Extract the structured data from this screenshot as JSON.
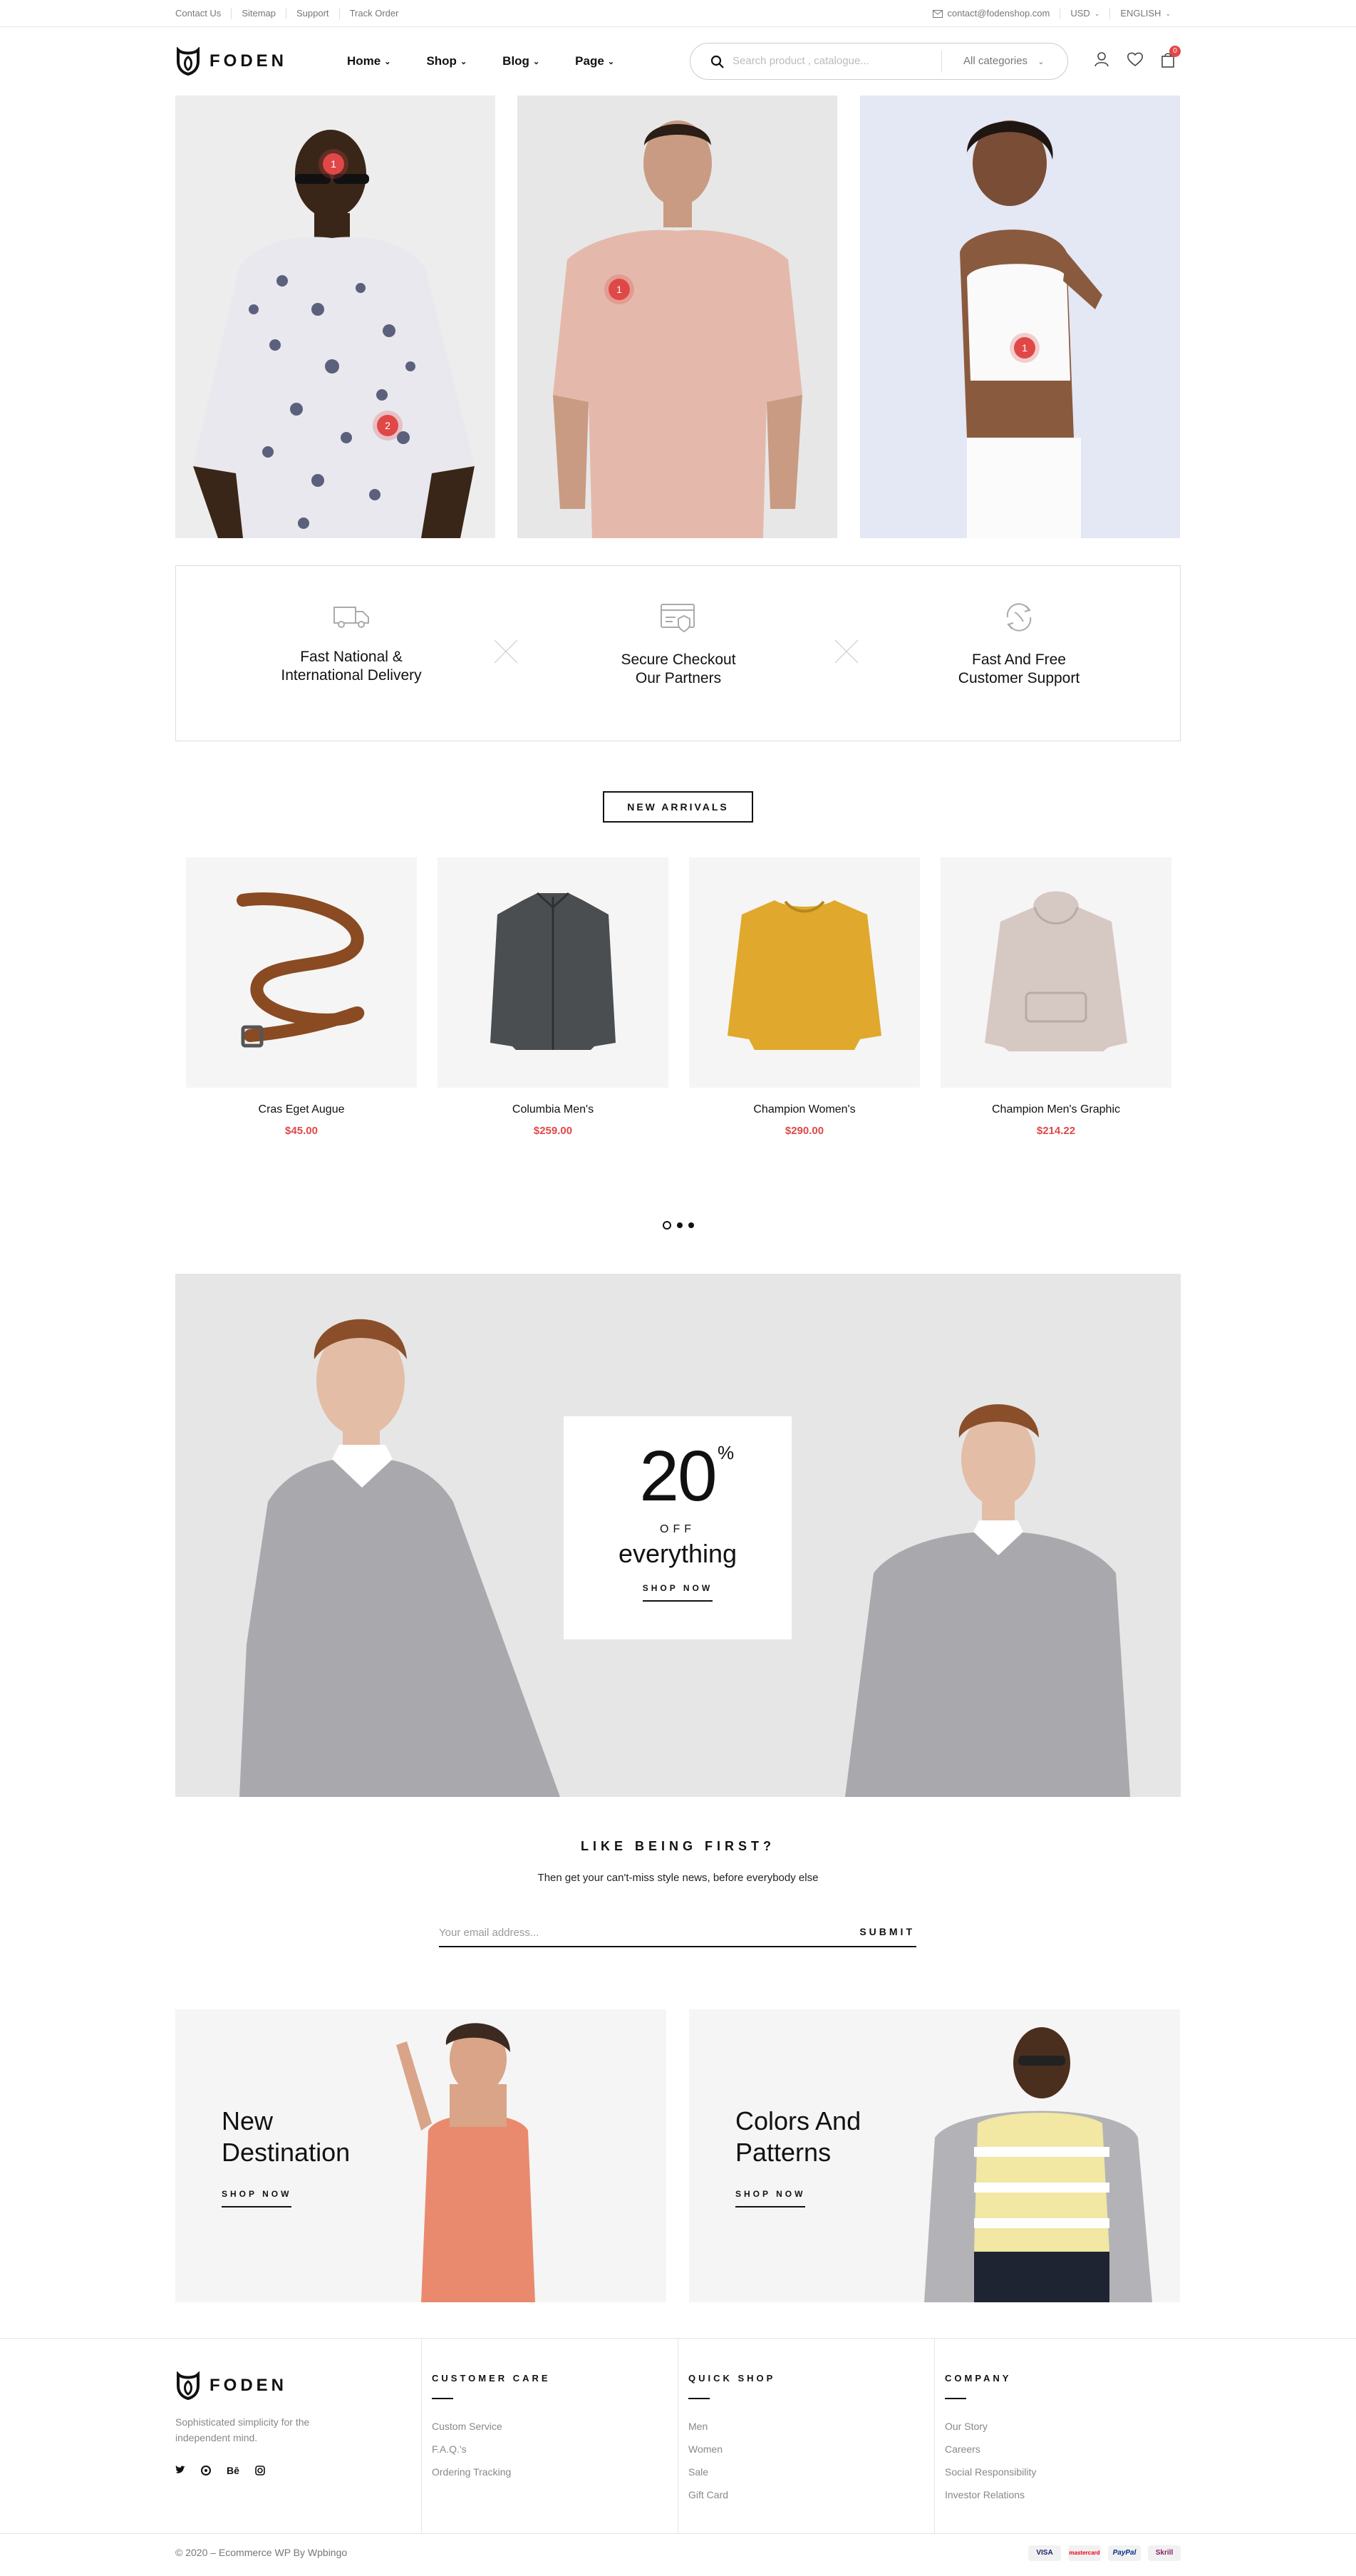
{
  "topbar": {
    "links": [
      "Contact Us",
      "Sitemap",
      "Support",
      "Track Order"
    ],
    "email": "contact@fodenshop.com",
    "currency": "USD",
    "language": "ENGLISH"
  },
  "header": {
    "logo": "FODEN",
    "nav": [
      "Home",
      "Shop",
      "Blog",
      "Page"
    ],
    "search_placeholder": "Search product , catalogue...",
    "category": "All categories",
    "cart_count": "0"
  },
  "hero": {
    "hotspots": [
      "1",
      "2",
      "1",
      "1"
    ]
  },
  "features": [
    {
      "line1": "Fast National &",
      "line2": "International Delivery",
      "icon": "truck-icon"
    },
    {
      "line1": "Secure Checkout",
      "line2": "Our Partners",
      "icon": "credit-card-icon"
    },
    {
      "line1": "Fast And Free",
      "line2": "Customer Support",
      "icon": "support-icon"
    }
  ],
  "new_arrivals": {
    "label": "NEW ARRIVALS",
    "products": [
      {
        "name": "Cras Eget Augue",
        "price": "$45.00"
      },
      {
        "name": "Columbia Men's",
        "price": "$259.00"
      },
      {
        "name": "Champion Women's",
        "price": "$290.00"
      },
      {
        "name": "Champion Men's Graphic",
        "price": "$214.22"
      }
    ]
  },
  "promo": {
    "big": "20",
    "pct": "%",
    "off": "OFF",
    "everything": "everything",
    "shop": "SHOP NOW"
  },
  "newsletter": {
    "title": "LIKE BEING FIRST?",
    "subtitle": "Then get your can't-miss style news, before everybody else",
    "placeholder": "Your email address...",
    "submit": "SUBMIT"
  },
  "banners": [
    {
      "line1": "New",
      "line2": "Destination",
      "shop": "SHOP NOW"
    },
    {
      "line1": "Colors And",
      "line2": "Patterns",
      "shop": "SHOP NOW"
    }
  ],
  "footer": {
    "logo": "FODEN",
    "desc": "Sophisticated simplicity for the independent mind.",
    "social": [
      "twitter-icon",
      "pinterest-icon",
      "behance-icon",
      "instagram-icon"
    ],
    "behance": "Bē",
    "columns": [
      {
        "title": "CUSTOMER CARE",
        "links": [
          "Custom Service",
          "F.A.Q.'s",
          "Ordering Tracking"
        ]
      },
      {
        "title": "QUICK SHOP",
        "links": [
          "Men",
          "Women",
          "Sale",
          "Gift Card"
        ]
      },
      {
        "title": "COMPANY",
        "links": [
          "Our Story",
          "Careers",
          "Social Responsibility",
          "Investor Relations"
        ]
      }
    ],
    "copyright": "© 2020 – Ecommerce WP By Wpbingo",
    "payments": [
      "VISA",
      "mastercard",
      "PayPal",
      "Skrill"
    ]
  },
  "colors": {
    "accent": "#e04848",
    "text": "#111111",
    "muted": "#888888"
  }
}
